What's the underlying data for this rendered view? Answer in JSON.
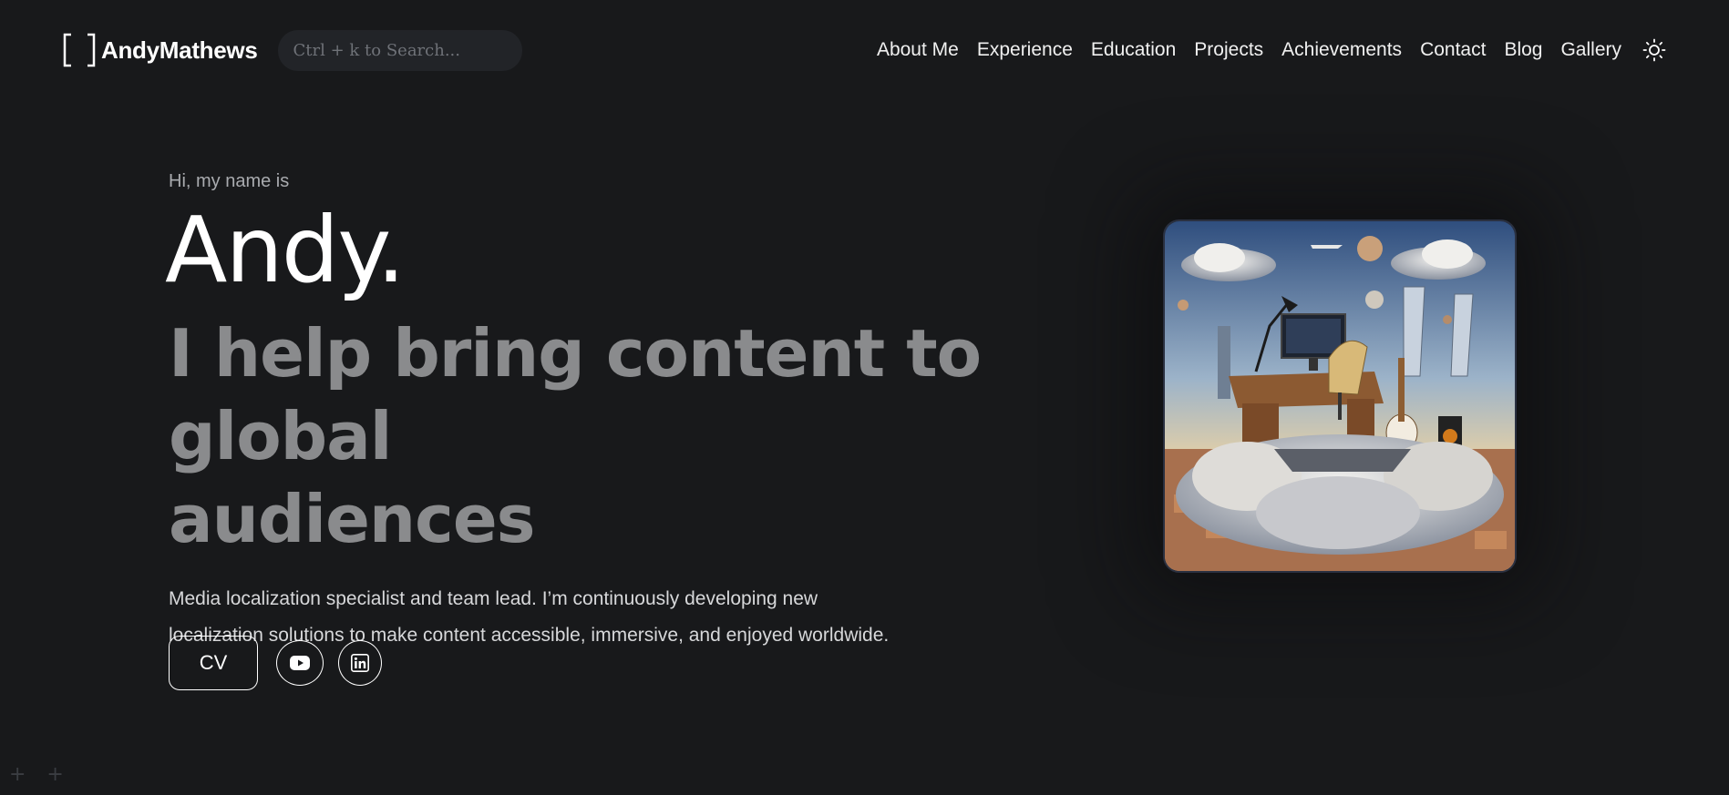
{
  "header": {
    "logo_text": "AndyMathews",
    "search_placeholder": "Ctrl + k to Search...",
    "nav": [
      "About Me",
      "Experience",
      "Education",
      "Projects",
      "Achievements",
      "Contact",
      "Blog",
      "Gallery"
    ],
    "theme_icon": "sun-icon"
  },
  "hero": {
    "greeting": "Hi, my name is",
    "name": "Andy.",
    "tagline_line1": "I help bring content to global",
    "tagline_line2": "audiences",
    "description": "Media localization specialist and team lead. I’m continuously developing new localization solutions to make content accessible, immersive, and enjoyed worldwide.",
    "cv_label": "CV",
    "social": [
      {
        "icon": "youtube-icon"
      },
      {
        "icon": "linkedin-icon"
      }
    ]
  },
  "decor": {
    "corner_marks": "+ +"
  },
  "colors": {
    "background": "#18191b",
    "text_primary": "#ffffff",
    "text_muted": "#8a8b8d",
    "search_bg": "#222428"
  }
}
